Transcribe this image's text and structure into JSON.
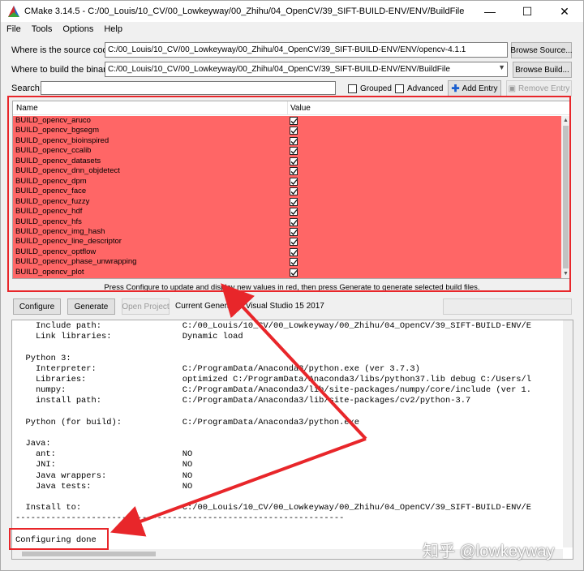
{
  "window": {
    "title": "CMake 3.14.5 - C:/00_Louis/10_CV/00_Lowkeyway/00_Zhihu/04_OpenCV/39_SIFT-BUILD-ENV/ENV/BuildFile",
    "minimize": "—",
    "maximize": "☐",
    "close": "✕"
  },
  "menu": {
    "file": "File",
    "tools": "Tools",
    "options": "Options",
    "help": "Help"
  },
  "source": {
    "label": "Where is the source code:",
    "value": "C:/00_Louis/10_CV/00_Lowkeyway/00_Zhihu/04_OpenCV/39_SIFT-BUILD-ENV/ENV/opencv-4.1.1",
    "browse": "Browse Source..."
  },
  "build": {
    "label": "Where to build the binaries:",
    "value": "C:/00_Louis/10_CV/00_Lowkeyway/00_Zhihu/04_OpenCV/39_SIFT-BUILD-ENV/ENV/BuildFile",
    "browse": "Browse Build..."
  },
  "search": {
    "label": "Search:",
    "value": "",
    "grouped": "Grouped",
    "advanced": "Advanced",
    "add_entry": "Add Entry",
    "remove_entry": "Remove Entry"
  },
  "table": {
    "col_name": "Name",
    "col_value": "Value",
    "rows": [
      "BUILD_opencv_aruco",
      "BUILD_opencv_bgsegm",
      "BUILD_opencv_bioinspired",
      "BUILD_opencv_ccalib",
      "BUILD_opencv_datasets",
      "BUILD_opencv_dnn_objdetect",
      "BUILD_opencv_dpm",
      "BUILD_opencv_face",
      "BUILD_opencv_fuzzy",
      "BUILD_opencv_hdf",
      "BUILD_opencv_hfs",
      "BUILD_opencv_img_hash",
      "BUILD_opencv_line_descriptor",
      "BUILD_opencv_optflow",
      "BUILD_opencv_phase_unwrapping",
      "BUILD_opencv_plot"
    ],
    "row_color": "#ff6666"
  },
  "status": "Press Configure to update and display new values in red, then press Generate to generate selected build files.",
  "actions": {
    "configure": "Configure",
    "generate": "Generate",
    "open_project": "Open Project",
    "generator": "Current Generator: Visual Studio 15 2017"
  },
  "output_lines": [
    "    Include path:                C:/00_Louis/10_CV/00_Lowkeyway/00_Zhihu/04_OpenCV/39_SIFT-BUILD-ENV/E",
    "    Link libraries:              Dynamic load",
    "",
    "  Python 3:",
    "    Interpreter:                 C:/ProgramData/Anaconda3/python.exe (ver 3.7.3)",
    "    Libraries:                   optimized C:/ProgramData/Anaconda3/libs/python37.lib debug C:/Users/l",
    "    numpy:                       C:/ProgramData/Anaconda3/lib/site-packages/numpy/core/include (ver 1.",
    "    install path:                C:/ProgramData/Anaconda3/lib/site-packages/cv2/python-3.7",
    "",
    "  Python (for build):            C:/ProgramData/Anaconda3/python.exe",
    "",
    "  Java:",
    "    ant:                         NO",
    "    JNI:                         NO",
    "    Java wrappers:               NO",
    "    Java tests:                  NO",
    "",
    "  Install to:                    C:/00_Louis/10_CV/00_Lowkeyway/00_Zhihu/04_OpenCV/39_SIFT-BUILD-ENV/E",
    "-----------------------------------------------------------------",
    "",
    "Configuring done"
  ],
  "watermark": "知乎 @lowkeyway",
  "annotation_color": "#e8262a",
  "icons": {
    "app": "cmake-triangle-icon",
    "add": "plus-icon",
    "remove": "remove-icon",
    "check": "checkmark-icon"
  }
}
